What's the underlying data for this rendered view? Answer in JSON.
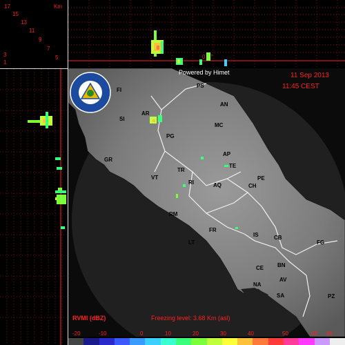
{
  "top_panel": {
    "height_unit": "Km",
    "height_labels": [
      "17",
      "15",
      "13",
      "11",
      "9",
      "7",
      "5",
      "3",
      "1"
    ],
    "freezing_marker": "0 C°"
  },
  "map": {
    "powered_by": "Powered by Himet",
    "date": "11 Sep 2013",
    "time": "11:45 CEST",
    "product": "RVMI (dBZ)",
    "freezing_level": "Freezing level: 3.68 Km (asl)",
    "logo_alt": "Protezione Civile",
    "cities": [
      {
        "code": "FI"
      },
      {
        "code": "PS"
      },
      {
        "code": "AN"
      },
      {
        "code": "SI"
      },
      {
        "code": "AR"
      },
      {
        "code": "MC"
      },
      {
        "code": "PG"
      },
      {
        "code": "GR"
      },
      {
        "code": "AP"
      },
      {
        "code": "TE"
      },
      {
        "code": "TR"
      },
      {
        "code": "VT"
      },
      {
        "code": "RI"
      },
      {
        "code": "PE"
      },
      {
        "code": "AQ"
      },
      {
        "code": "CH"
      },
      {
        "code": "RM"
      },
      {
        "code": "FR"
      },
      {
        "code": "IS"
      },
      {
        "code": "CB"
      },
      {
        "code": "FG"
      },
      {
        "code": "LT"
      },
      {
        "code": "CE"
      },
      {
        "code": "BN"
      },
      {
        "code": "AV"
      },
      {
        "code": "NA"
      },
      {
        "code": "SA"
      },
      {
        "code": "PZ"
      }
    ]
  },
  "colorbar": {
    "tick_labels": [
      "-20",
      "-10",
      "0",
      "10",
      "20",
      "30",
      "40",
      "50",
      "60",
      "65"
    ],
    "colors": [
      "#444444",
      "#1a1a8c",
      "#2a2acc",
      "#3a5aff",
      "#3a9aff",
      "#3ad0ff",
      "#3affd0",
      "#3aff7a",
      "#7aff3a",
      "#c0ff3a",
      "#ffff3a",
      "#ffc03a",
      "#ff7a3a",
      "#ff3a3a",
      "#ff3a9a",
      "#ff3aff",
      "#cc99ff",
      "#eeeeee"
    ]
  }
}
